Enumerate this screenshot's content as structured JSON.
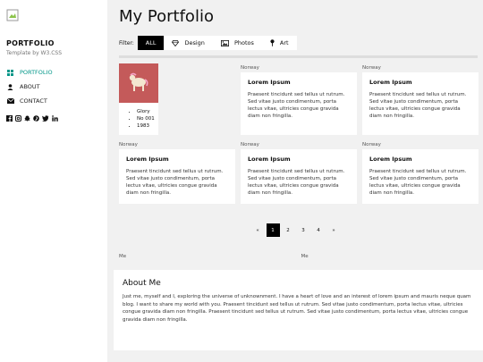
{
  "sidebar": {
    "brand": "PORTFOLIO",
    "subtitle": "Template by W3.CSS",
    "nav": [
      {
        "label": "PORTFOLIO",
        "icon": "grid-icon",
        "active": true
      },
      {
        "label": "ABOUT",
        "icon": "user-icon",
        "active": false
      },
      {
        "label": "CONTACT",
        "icon": "envelope-icon",
        "active": false
      }
    ],
    "socials": [
      "facebook-icon",
      "instagram-icon",
      "snapchat-icon",
      "pinterest-icon",
      "twitter-icon",
      "linkedin-icon"
    ]
  },
  "main": {
    "title": "My Portfolio",
    "filter_label": "Filter:",
    "filters": [
      {
        "label": "ALL",
        "icon": "",
        "active": true
      },
      {
        "label": "Design",
        "icon": "diamond-icon",
        "active": false
      },
      {
        "label": "Photos",
        "icon": "photo-icon",
        "active": false
      },
      {
        "label": "Art",
        "icon": "map-marker-icon",
        "active": false
      }
    ],
    "first_card": {
      "items": [
        "Glory",
        "No 001",
        "1983"
      ]
    },
    "card": {
      "img_alt": "Norway",
      "title": "Lorem Ipsum",
      "text": "Praesent tincidunt sed tellus ut rutrum. Sed vitae justo condimentum, porta lectus vitae, ultricies congue gravida diam non fringilla."
    },
    "pagination": [
      "«",
      "1",
      "2",
      "3",
      "4",
      "»"
    ],
    "active_page": "1",
    "me_images": [
      "Me",
      "Me"
    ],
    "about": {
      "title": "About Me",
      "text": "Just me, myself and I, exploring the universe of unknownment. I have a heart of love and an interest of lorem ipsum and mauris neque quam blog. I want to share my world with you. Praesent tincidunt sed tellus ut rutrum. Sed vitae justo condimentum, porta lectus vitae, ultricies congue gravida diam non fringilla. Praesent tincidunt sed tellus ut rutrum. Sed vitae justo condimentum, porta lectus vitae, ultricies congue gravida diam non fringilla."
    }
  },
  "colors": {
    "accent": "#009688",
    "active_filter": "#000000",
    "card_bg": "#ffffff",
    "page_bg": "#f1f1f1"
  }
}
